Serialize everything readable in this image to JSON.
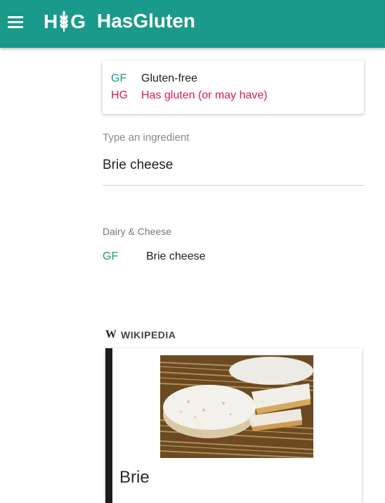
{
  "appbar": {
    "logo_left": "H",
    "logo_right": "G",
    "title": "HasGluten",
    "menu_icon": "hamburger-menu-icon",
    "logo_icon": "wheat-icon",
    "background": "#1a9a8a"
  },
  "legend": {
    "items": [
      {
        "code": "GF",
        "text": "Gluten-free",
        "color": "#1a9a8a"
      },
      {
        "code": "HG",
        "text": "Has gluten (or may have)",
        "color": "#d81b60"
      }
    ]
  },
  "search": {
    "label": "Type an ingredient",
    "value": "Brie cheese"
  },
  "results": {
    "category": "Dairy & Cheese",
    "items": [
      {
        "code": "GF",
        "name": "Brie cheese"
      }
    ]
  },
  "wikipedia": {
    "logo_icon": "wikipedia-w-icon",
    "w": "W",
    "source_label": "WIKIPEDIA",
    "article_title": "Brie",
    "image_icon": "brie-cheese-photo"
  }
}
